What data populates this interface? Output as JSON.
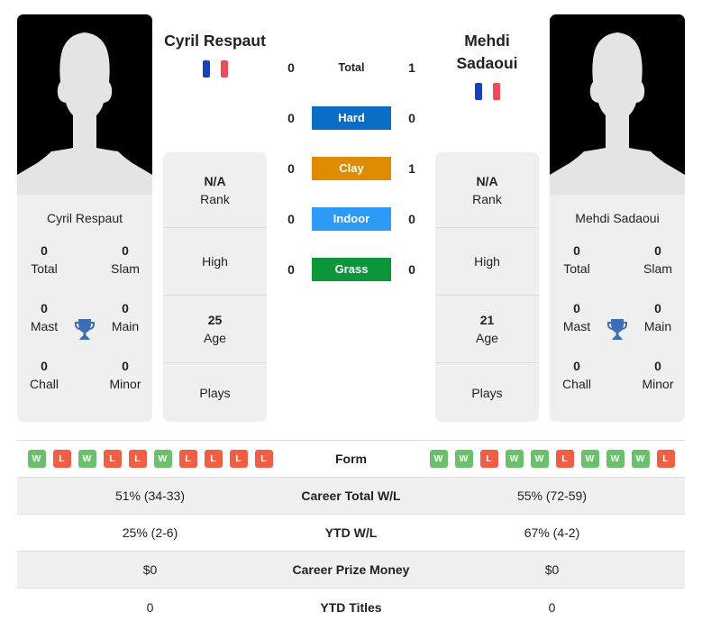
{
  "players": {
    "left": {
      "name": "Cyril Respaut",
      "heading": "Cyril Respaut",
      "country": "France",
      "titles": {
        "total": "0",
        "total_label": "Total",
        "slam": "0",
        "slam_label": "Slam",
        "mast": "0",
        "mast_label": "Mast",
        "main": "0",
        "main_label": "Main",
        "chall": "0",
        "chall_label": "Chall",
        "minor": "0",
        "minor_label": "Minor"
      },
      "info": {
        "rank_value": "N/A",
        "rank_label": "Rank",
        "high_label": "High",
        "age_value": "25",
        "age_label": "Age",
        "plays_label": "Plays"
      },
      "form": [
        "W",
        "L",
        "W",
        "L",
        "L",
        "W",
        "L",
        "L",
        "L",
        "L"
      ]
    },
    "right": {
      "name": "Mehdi Sadaoui",
      "heading_line1": "Mehdi",
      "heading_line2": "Sadaoui",
      "country": "France",
      "titles": {
        "total": "0",
        "total_label": "Total",
        "slam": "0",
        "slam_label": "Slam",
        "mast": "0",
        "mast_label": "Mast",
        "main": "0",
        "main_label": "Main",
        "chall": "0",
        "chall_label": "Chall",
        "minor": "0",
        "minor_label": "Minor"
      },
      "info": {
        "rank_value": "N/A",
        "rank_label": "Rank",
        "high_label": "High",
        "age_value": "21",
        "age_label": "Age",
        "plays_label": "Plays"
      },
      "form": [
        "W",
        "W",
        "L",
        "W",
        "W",
        "L",
        "W",
        "W",
        "W",
        "L"
      ]
    }
  },
  "h2h": [
    {
      "label": "Total",
      "left": "0",
      "right": "1",
      "color": null
    },
    {
      "label": "Hard",
      "left": "0",
      "right": "0",
      "color": "#0a6fc4"
    },
    {
      "label": "Clay",
      "left": "0",
      "right": "1",
      "color": "#de8b00"
    },
    {
      "label": "Indoor",
      "left": "0",
      "right": "0",
      "color": "#2b9bf5"
    },
    {
      "label": "Grass",
      "left": "0",
      "right": "0",
      "color": "#0a9639"
    }
  ],
  "stats": {
    "form_label": "Form",
    "rows": [
      {
        "label": "Career Total W/L",
        "left": "51% (34-33)",
        "right": "55% (72-59)"
      },
      {
        "label": "YTD W/L",
        "left": "25% (2-6)",
        "right": "67% (4-2)"
      },
      {
        "label": "Career Prize Money",
        "left": "$0",
        "right": "$0"
      },
      {
        "label": "YTD Titles",
        "left": "0",
        "right": "0"
      }
    ]
  },
  "colors": {
    "win": "#6cbf6c",
    "loss": "#ef5f45",
    "trophy": "#3a6fb5"
  }
}
